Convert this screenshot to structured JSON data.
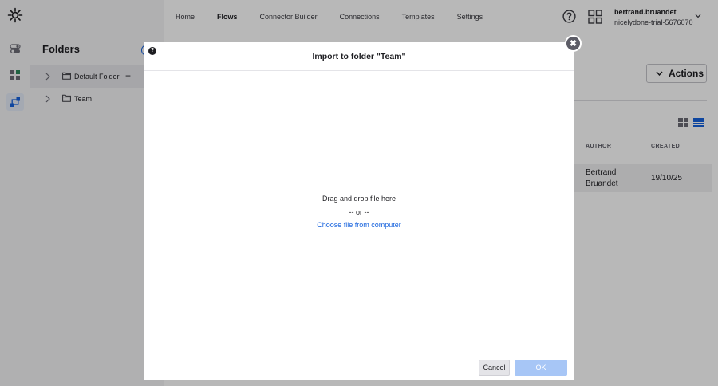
{
  "brand": {
    "name": "okta",
    "logo_icon": "okta-sunburst-icon"
  },
  "rail": {
    "items": [
      {
        "icon": "toggle-icon"
      },
      {
        "icon": "puzzle-icon"
      },
      {
        "icon": "flows-icon",
        "active": true
      }
    ]
  },
  "folders": {
    "title": "Folders",
    "items": [
      {
        "label": "Default Folder",
        "selected": true
      },
      {
        "label": "Team",
        "selected": false
      }
    ]
  },
  "nav": {
    "tabs": [
      "Home",
      "Flows",
      "Connector Builder",
      "Connections",
      "Templates",
      "Settings"
    ],
    "active": "Flows"
  },
  "user": {
    "name": "bertrand.bruandet",
    "org": "nicelydone-trial-5676070"
  },
  "toolbar": {
    "actions_label": "Actions"
  },
  "table": {
    "columns": {
      "author": "AUTHOR",
      "created": "CREATED"
    },
    "rows": [
      {
        "author_line1": "Bertrand",
        "author_line2": "Bruandet",
        "created": "19/10/25"
      }
    ]
  },
  "modal": {
    "title": "Import to folder \"Team\"",
    "help_glyph": "?",
    "dropzone": {
      "text": "Drag and drop file here",
      "separator": "-- or --",
      "link": "Choose file from computer"
    },
    "cancel_label": "Cancel",
    "ok_label": "OK",
    "close_glyph": "✖"
  },
  "colors": {
    "accent": "#1662dd",
    "ok_disabled": "#a7c6f6"
  }
}
